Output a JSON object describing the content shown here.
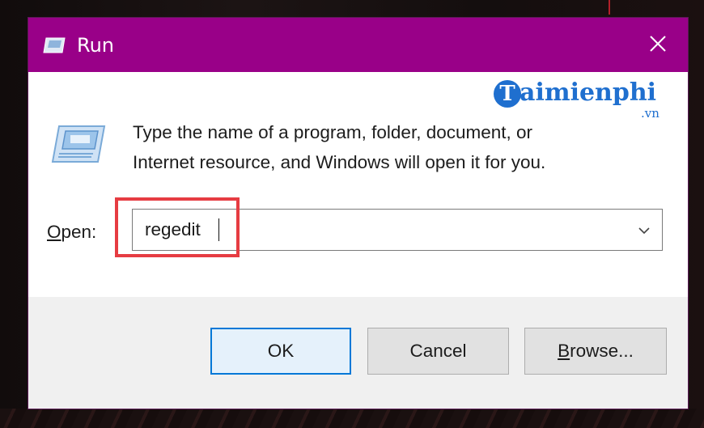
{
  "window": {
    "title": "Run",
    "close_icon": "close-icon",
    "titlebar_color": "#990088"
  },
  "watermark": {
    "letter": "T",
    "text": "aimienphi",
    "suffix": ".vn"
  },
  "content": {
    "description_line1": "Type the name of a program, folder, document, or",
    "description_line2": "Internet resource, and Windows will open it for you.",
    "open_label_underlined": "O",
    "open_label_rest": "pen:",
    "open_value": "regedit",
    "highlight_color": "#e63c42"
  },
  "buttons": {
    "ok": "OK",
    "cancel": "Cancel",
    "browse_underlined": "B",
    "browse_rest": "rowse..."
  },
  "colors": {
    "accent": "#0078d7",
    "watermark": "#1f6fcf"
  }
}
